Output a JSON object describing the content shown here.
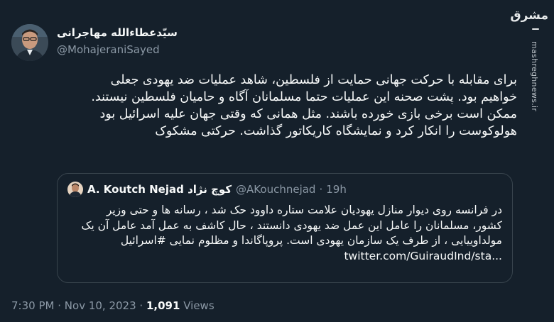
{
  "author": {
    "name": "سیّدعطاءالله مهاجرانی",
    "handle": "@MohajeraniSayed"
  },
  "tweet": {
    "lines": [
      "برای مقابله با حرکت جهانی حمایت از فلسطین، شاهد عملیات ضد یهودی جعلی",
      "خواهیم بود. پشت صحنه این عملیات حتما مسلمانان آگاه و حامیان فلسطین نیستند.",
      "ممکن است برخی بازی خورده باشند.  مثل همانی که وقتی جهان علیه اسرائیل بود",
      "هولوکوست را انکار کرد و نمایشگاه کاریکاتور گذاشت. حرکتی مشکوک"
    ]
  },
  "quote": {
    "name": "A. Koutch Nejad کوچ نژاد",
    "handle": "@AKouchnejad",
    "separator": "·",
    "time": "19h",
    "lines": [
      "در فرانسه روی دیوار منازل یهودیان علامت ستاره داوود حک شد ، رسانه ها و حتی وزیر",
      "کشور، مسلمانان را عامل این عمل ضد یهودی دانستند ، حال کاشف به عمل آمد عامل آن یک",
      "مولداوییایی ، از طرف یک سازمان یهودی است. پروپاگاندا و مظلوم نمایی #اسرائیل"
    ],
    "link": "twitter.com/GuiraudInd/sta..."
  },
  "meta": {
    "time": "7:30 PM",
    "separator": "·",
    "date": "Nov 10, 2023",
    "views_count": "1,091",
    "views_label": "Views"
  },
  "watermark": {
    "logo": "مشرق",
    "site": "mashreghnews.ir"
  },
  "colors": {
    "background": "#15202b",
    "text": "#f7f9f9",
    "secondary": "#8b98a5",
    "border": "#38444d"
  },
  "icons": [
    "author-avatar",
    "quote-author-avatar",
    "mashregh-logo"
  ]
}
